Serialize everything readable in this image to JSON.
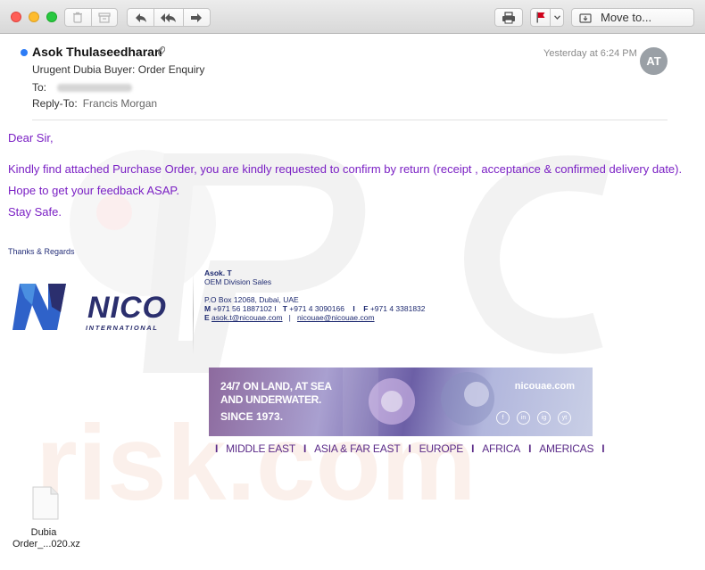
{
  "toolbar": {
    "move_to_label": "Move to..."
  },
  "header": {
    "sender": "Asok Thulaseedharan",
    "date": "Yesterday at 6:24 PM",
    "avatar_initials": "AT",
    "subject": "Urugent Dubia Buyer: Order Enquiry",
    "to_label": "To:",
    "reply_to_label": "Reply-To:",
    "reply_to_value": "Francis Morgan"
  },
  "body": {
    "greeting": "Dear Sir,",
    "line1": "Kindly find attached Purchase Order, you are kindly requested to confirm by return (receipt , acceptance & confirmed delivery date).",
    "line2": "Hope to get your feedback ASAP.",
    "line3": "Stay Safe.",
    "thanks": "Thanks & Regards"
  },
  "logo": {
    "name": "NICO",
    "sub": "INTERNATIONAL"
  },
  "signature": {
    "name": "Asok. T",
    "title": "OEM Division Sales",
    "address": "P.O Box 12068, Dubai, UAE",
    "m_label": "M",
    "mobile": "+971 56 1887102 I",
    "t_label": "T",
    "phone": "+971 4 3090166",
    "sep": "I",
    "f_label": "F",
    "fax": "+971 4 3381832",
    "e_label": "E",
    "email1": "asok.t@nicouae.com",
    "email_sep": "|",
    "email2": "nicouae@nicouae.com"
  },
  "banner": {
    "line1": "24/7 ON LAND, AT SEA",
    "line2": "AND UNDERWATER.",
    "line3": "SINCE 1973.",
    "site": "nicouae.com",
    "social": [
      "f",
      "in",
      "ig",
      "yt"
    ]
  },
  "regions": [
    "MIDDLE EAST",
    "ASIA & FAR EAST",
    "EUROPE",
    "AFRICA",
    "AMERICAS"
  ],
  "attachment": {
    "name_line1": "Dubia",
    "name_line2": "Order_...020.xz"
  },
  "colors": {
    "body_text": "#7a1fc4",
    "signature": "#1e2a70",
    "logo_blue": "#2f62c9",
    "logo_navy": "#2b2f6e",
    "flag_red": "#d0021b",
    "unread_blue": "#2d7cf6"
  }
}
